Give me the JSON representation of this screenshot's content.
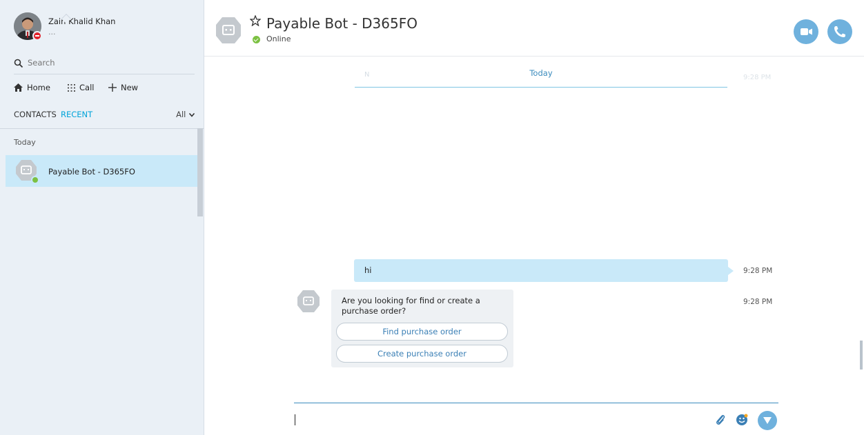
{
  "profile": {
    "name": "Zain Khalid Khan",
    "mood": "..."
  },
  "search": {
    "placeholder": "Search"
  },
  "nav": {
    "home": "Home",
    "call": "Call",
    "new": "New"
  },
  "tabs": {
    "contacts": "CONTACTS",
    "recent": "RECENT",
    "filter": "All"
  },
  "recent_list": {
    "section": "Today",
    "items": [
      {
        "name": "Payable Bot - D365FO",
        "status": "online"
      }
    ]
  },
  "header": {
    "title": "Payable Bot - D365FO",
    "status": "Online"
  },
  "conversation": {
    "date_separator": "Today",
    "faded_initial": "N",
    "faded_time": "9:28 PM",
    "messages": [
      {
        "from": "me",
        "text": "hi",
        "time": "9:28 PM"
      },
      {
        "from": "bot",
        "text": "Are you looking for find or create a purchase order?",
        "time": "9:28 PM",
        "buttons": [
          "Find purchase order",
          "Create purchase order"
        ]
      }
    ]
  },
  "colors": {
    "accent": "#00a3d9",
    "selected_row": "#c9e9f9",
    "button_blue": "#6fb1dd",
    "online": "#7cc142",
    "busy": "#e0202a"
  },
  "icons": [
    "search-icon",
    "home-icon",
    "dialpad-icon",
    "plus-icon",
    "chevron-down-icon",
    "star-icon",
    "video-call-icon",
    "phone-icon",
    "paperclip-icon",
    "emoji-icon",
    "send-icon",
    "bot-avatar-icon"
  ]
}
